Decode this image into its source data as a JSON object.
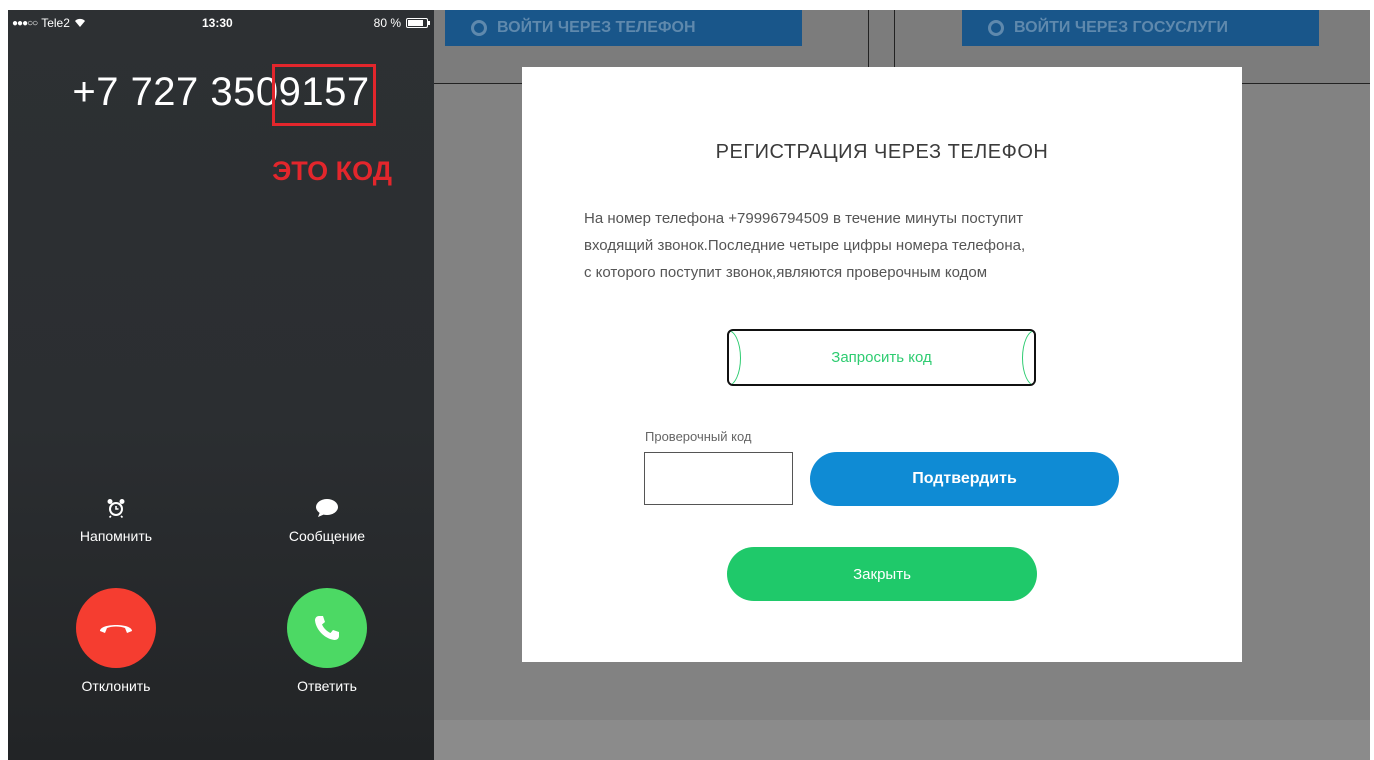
{
  "phone": {
    "status_bar": {
      "signal": "●●●○○",
      "carrier": "Tele2",
      "time": "13:30",
      "battery": "80 %"
    },
    "caller_number": "+7 727 3509157",
    "code_annotation": "ЭТО КОД",
    "actions": {
      "remind_label": "Напомнить",
      "message_label": "Сообщение",
      "decline_label": "Отклонить",
      "answer_label": "Ответить"
    },
    "colors": {
      "decline": "#f53d30",
      "answer": "#4cd964",
      "annotation": "#e3262c"
    }
  },
  "webpage": {
    "login_phone_label": "ВОЙТИ ЧЕРЕЗ ТЕЛЕФОН",
    "login_gosuslugi_label": "ВОЙТИ ЧЕРЕЗ ГОСУСЛУГИ"
  },
  "modal": {
    "title": "РЕГИСТРАЦИЯ ЧЕРЕЗ ТЕЛЕФОН",
    "description_lines": [
      "На номер телефона +79996794509 в течение минуты поступит",
      "входящий звонок.Последние четыре цифры номера телефона,",
      "с которого поступит звонок,являются проверочным кодом"
    ],
    "request_code_label": "Запросить код",
    "code_field_label": "Проверочный код",
    "code_field_value": "",
    "confirm_label": "Подтвердить",
    "close_label": "Закрыть",
    "colors": {
      "confirm": "#0f8bd4",
      "close": "#1fc96a",
      "request_text": "#2ecc71"
    }
  }
}
